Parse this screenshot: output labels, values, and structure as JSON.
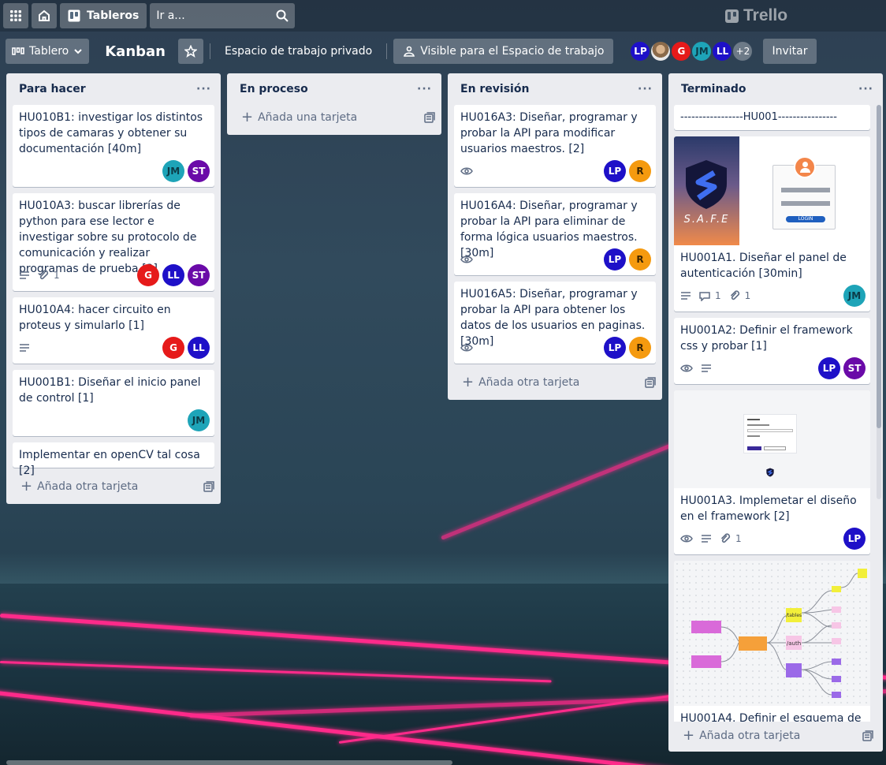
{
  "nav": {
    "boards_label": "Tableros",
    "search_placeholder": "Ir a...",
    "brand": "Trello"
  },
  "board": {
    "view_label": "Tablero",
    "title": "Kanban",
    "workspace": "Espacio de trabajo privado",
    "visibility": "Visible para el Espacio de trabajo",
    "members": [
      "LP",
      "photo",
      "G",
      "JM",
      "LL"
    ],
    "more_members": "+2",
    "invite": "Invitar"
  },
  "lists": {
    "todo": {
      "title": "Para hacer",
      "add": "Añada otra tarjeta",
      "cards": [
        {
          "title": "HU010B1: investigar los distintos tipos de camaras y obtener su documentación [40m]",
          "members": [
            "JM",
            "ST"
          ]
        },
        {
          "title": "HU010A3: buscar librerías de python para ese lector e investigar sobre su protocolo de comunicación y realizar programas de prueba [3]",
          "attachments": "1",
          "members": [
            "G",
            "LL",
            "ST"
          ]
        },
        {
          "title": "HU010A4: hacer circuito en proteus y simularlo [1]",
          "members": [
            "G",
            "LL"
          ]
        },
        {
          "title": "HU001B1: Diseñar el inicio panel de control [1]",
          "members": [
            "JM"
          ]
        },
        {
          "title": "Implementar en openCV tal cosa [2]"
        }
      ]
    },
    "doing": {
      "title": "En proceso",
      "add": "Añada una tarjeta"
    },
    "review": {
      "title": "En revisión",
      "add": "Añada otra tarjeta",
      "cards": [
        {
          "title": "HU016A3: Diseñar, programar y probar la API para modificar usuarios maestros. [2]",
          "members": [
            "LP",
            "R"
          ]
        },
        {
          "title": "HU016A4: Diseñar, programar y probar la API para eliminar de forma lógica usuarios maestros. [30m]",
          "members": [
            "LP",
            "R"
          ]
        },
        {
          "title": "HU016A5: Diseñar, programar y probar la API para obtener los datos de los usuarios en paginas. [30m]",
          "members": [
            "LP",
            "R"
          ]
        }
      ]
    },
    "done": {
      "title": "Terminado",
      "add": "Añada otra tarjeta",
      "cards": [
        {
          "title": "-----------------HU001----------------"
        },
        {
          "title": "HU001A1. Diseñar el panel de autenticación [30min]",
          "cover_brand": "S.A.F.E",
          "login_button": "LOGIN",
          "comments": "1",
          "attachments": "1",
          "members": [
            "JM"
          ]
        },
        {
          "title": "HU001A2: Definir el framework css y probar [1]",
          "members": [
            "LP",
            "ST"
          ]
        },
        {
          "title": "HU001A3. Implemetar el diseño en el framework [2]",
          "attachments": "1",
          "members": [
            "LP"
          ]
        },
        {
          "title": "HU001A4. Definir el esquema de la",
          "mindmap": {
            "center": "/auth",
            "nodes": [
              "/tables",
              "/auth"
            ]
          }
        }
      ]
    }
  }
}
